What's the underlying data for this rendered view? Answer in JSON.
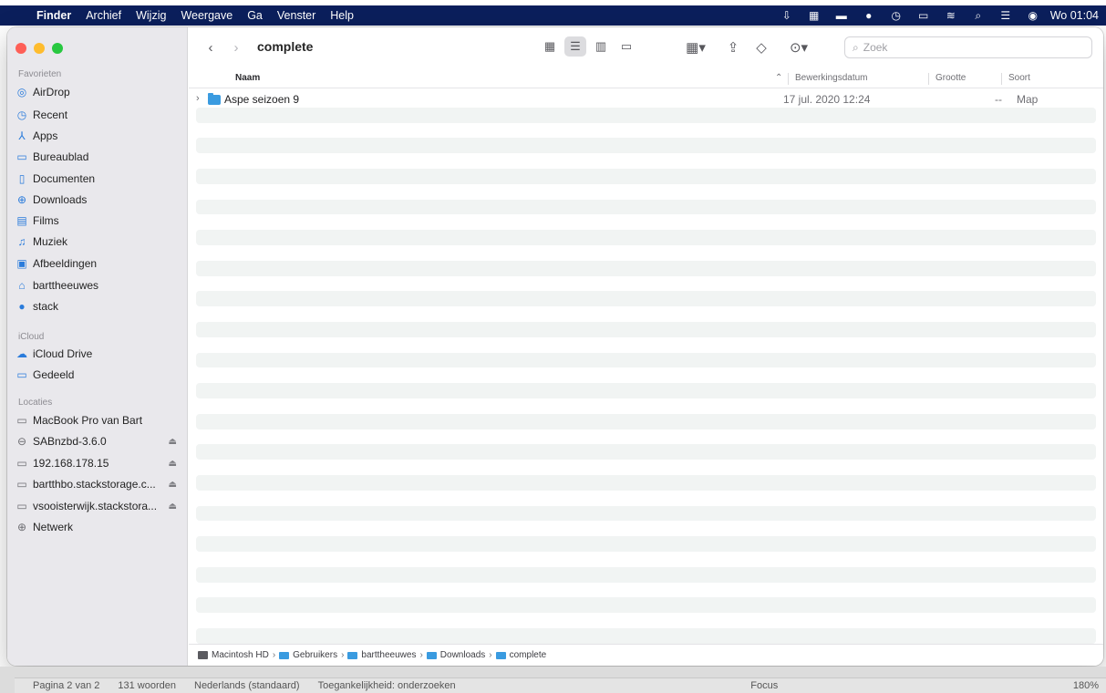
{
  "menubar": {
    "app": "Finder",
    "items": [
      "Archief",
      "Wijzig",
      "Weergave",
      "Ga",
      "Venster",
      "Help"
    ],
    "clock": "Wo 01:04"
  },
  "window": {
    "title": "complete",
    "search_placeholder": "Zoek"
  },
  "sidebar": {
    "sections": {
      "favorites": "Favorieten",
      "icloud": "iCloud",
      "locations": "Locaties"
    },
    "favorites": [
      "AirDrop",
      "Recent",
      "Apps",
      "Bureaublad",
      "Documenten",
      "Downloads",
      "Films",
      "Muziek",
      "Afbeeldingen",
      "barttheeuwes",
      "stack"
    ],
    "icloud": [
      "iCloud Drive",
      "Gedeeld"
    ],
    "locations": [
      "MacBook Pro van Bart",
      "SABnzbd-3.6.0",
      "192.168.178.15",
      "bartthbo.stackstorage.c...",
      "vsooisterwijk.stackstora...",
      "Netwerk"
    ]
  },
  "columns": {
    "name": "Naam",
    "date": "Bewerkingsdatum",
    "size": "Grootte",
    "kind": "Soort"
  },
  "files": [
    {
      "name": "Aspe seizoen 9",
      "date": "17 jul. 2020 12:24",
      "size": "--",
      "kind": "Map"
    }
  ],
  "pathbar": [
    "Macintosh HD",
    "Gebruikers",
    "barttheeuwes",
    "Downloads",
    "complete"
  ],
  "wordbar": {
    "page": "Pagina 2 van 2",
    "words": "131 woorden",
    "language": "Nederlands (standaard)",
    "accessibility": "Toegankelijkheid: onderzoeken",
    "focus": "Focus",
    "zoom": "180%"
  }
}
